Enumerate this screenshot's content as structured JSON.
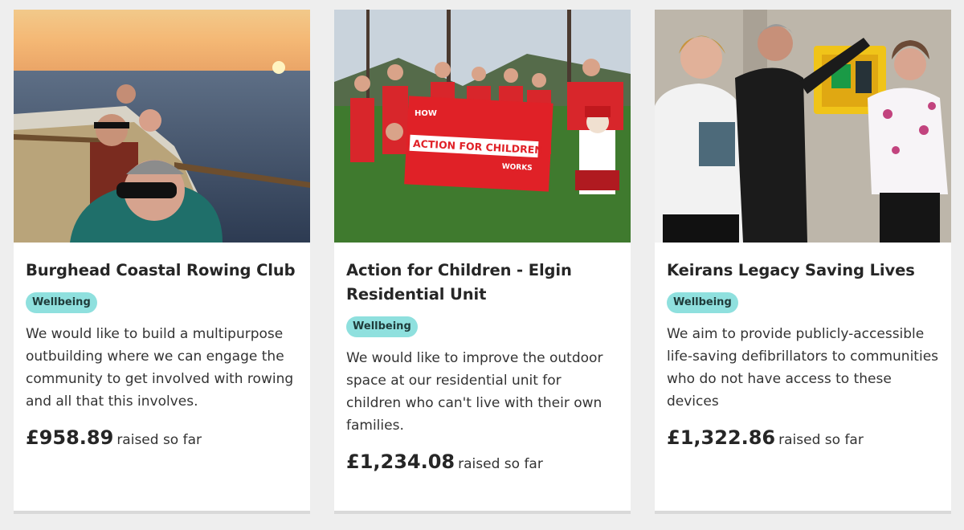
{
  "cards": [
    {
      "title": "Burghead Coastal Rowing Club",
      "tag": "Wellbeing",
      "description": "We would like to build a multipurpose outbuilding where we can engage the community to get involved with rowing and all that this involves.",
      "amount": "£958.89",
      "raised_suffix": "raised so far",
      "image_subject": "rowing-boat-at-sunset"
    },
    {
      "title": "Action for Children - Elgin Residential Unit",
      "tag": "Wellbeing",
      "description": "We would like to improve the outdoor space at our residential unit for children who can't live with their own families.",
      "amount": "£1,234.08",
      "raised_suffix": "raised so far",
      "image_subject": "group-with-red-banner",
      "banner_text_top": "HOW",
      "banner_text_main": "ACTION FOR CHILDREN",
      "banner_text_bottom": "WORKS"
    },
    {
      "title": "Keirans Legacy Saving Lives",
      "tag": "Wellbeing",
      "description": "We aim to provide publicly-accessible life-saving defibrillators to communities who do not have access to these devices",
      "amount": "£1,322.86",
      "raised_suffix": "raised so far",
      "image_subject": "three-people-beside-defibrillator"
    }
  ],
  "colors": {
    "tag_bg": "#8fe0de",
    "page_bg": "#eeeeee",
    "card_bg": "#ffffff"
  }
}
